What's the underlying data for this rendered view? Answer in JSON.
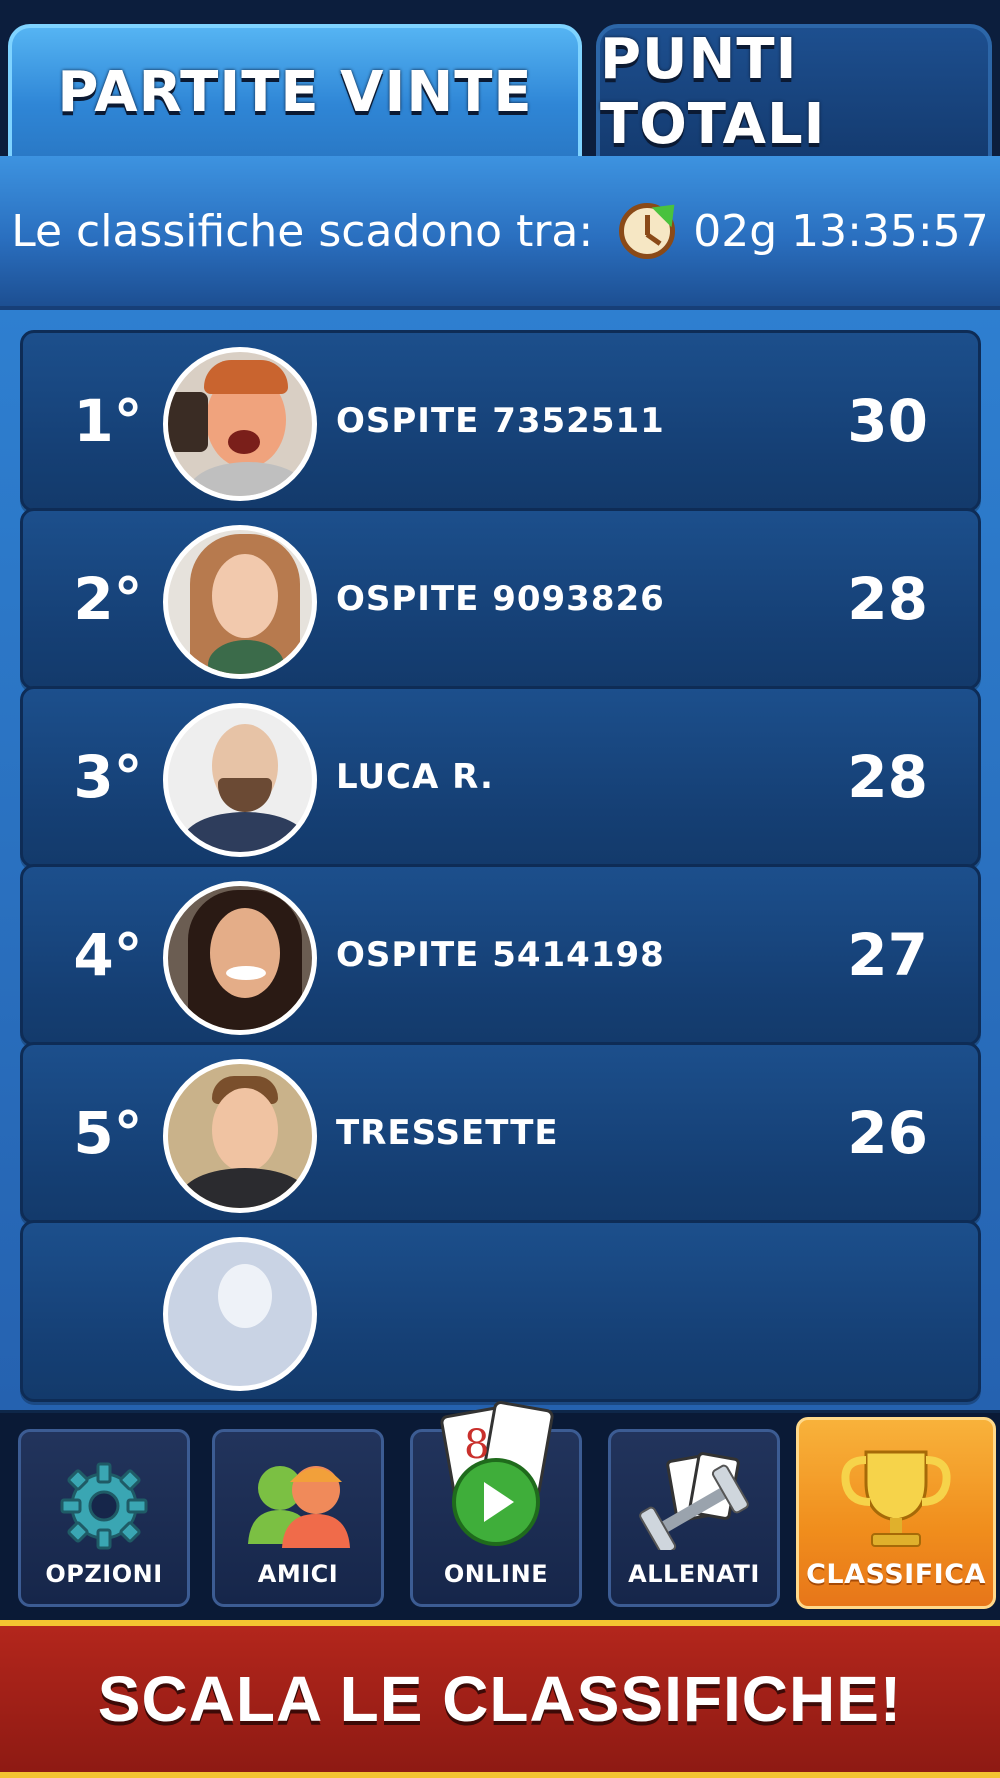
{
  "tabs": [
    {
      "label": "PARTITE VINTE",
      "active": true
    },
    {
      "label": "PUNTI TOTALI",
      "active": false
    }
  ],
  "timer": {
    "label": "Le classifiche scadono tra:",
    "value": "02g 13:35:57",
    "icon": "clock-refresh-icon"
  },
  "leaderboard": [
    {
      "rank": "1°",
      "name": "OSPITE 7352511",
      "score": "30"
    },
    {
      "rank": "2°",
      "name": "OSPITE 9093826",
      "score": "28"
    },
    {
      "rank": "3°",
      "name": "LUCA R.",
      "score": "28"
    },
    {
      "rank": "4°",
      "name": "OSPITE 5414198",
      "score": "27"
    },
    {
      "rank": "5°",
      "name": "TRESSETTE",
      "score": "26"
    },
    {
      "rank": "",
      "name": "",
      "score": ""
    }
  ],
  "nav": [
    {
      "label": "OPZIONI",
      "icon": "gear-icon"
    },
    {
      "label": "AMICI",
      "icon": "friends-icon"
    },
    {
      "label": "ONLINE",
      "icon": "cards-play-icon"
    },
    {
      "label": "ALLENATI",
      "icon": "dumbbell-cards-icon"
    },
    {
      "label": "CLASSIFICA",
      "icon": "trophy-icon",
      "active": true
    }
  ],
  "banner": {
    "text": "SCALA LE CLASSIFICHE!"
  },
  "colors": {
    "accent_orange": "#f08d1c",
    "banner_red": "#b3261c",
    "list_blue": "#2a71c0"
  }
}
